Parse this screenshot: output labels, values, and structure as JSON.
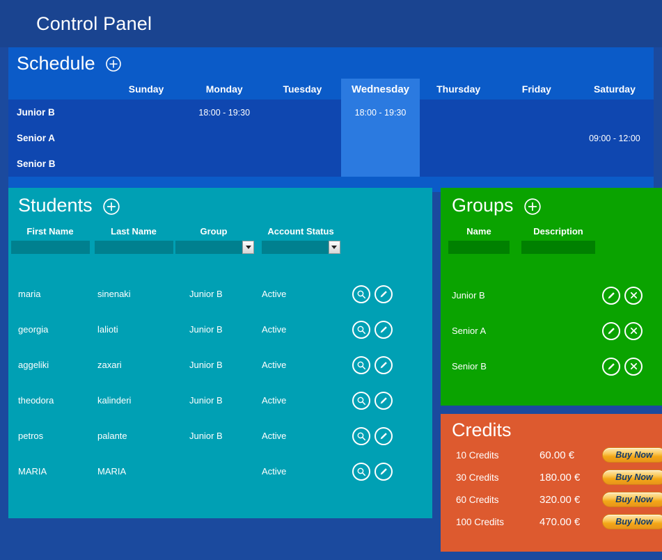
{
  "topbar": {
    "title": "Control Panel"
  },
  "schedule": {
    "title": "Schedule",
    "add_icon": "plus-circle-icon",
    "days": [
      "Sunday",
      "Monday",
      "Tuesday",
      "Wednesday",
      "Thursday",
      "Friday",
      "Saturday"
    ],
    "highlighted_day": "Wednesday",
    "rows": [
      {
        "group": "Junior B",
        "cells": [
          "",
          "18:00 - 19:30",
          "",
          "18:00 - 19:30",
          "",
          "",
          ""
        ]
      },
      {
        "group": "Senior A",
        "cells": [
          "",
          "",
          "",
          "",
          "",
          "",
          "09:00 - 12:00"
        ]
      },
      {
        "group": "Senior B",
        "cells": [
          "",
          "",
          "",
          "",
          "",
          "",
          ""
        ]
      }
    ]
  },
  "students": {
    "title": "Students",
    "add_icon": "plus-circle-icon",
    "columns": [
      "First Name",
      "Last Name",
      "Group",
      "Account Status"
    ],
    "filters": {
      "first_name": "",
      "last_name": "",
      "group": "",
      "account_status": ""
    },
    "rows": [
      {
        "first_name": "maria",
        "last_name": "sinenaki",
        "group": "Junior B",
        "status": "Active",
        "view_icon": "search-icon",
        "edit_icon": "pencil-icon"
      },
      {
        "first_name": "georgia",
        "last_name": "lalioti",
        "group": "Junior B",
        "status": "Active",
        "view_icon": "search-icon",
        "edit_icon": "pencil-icon"
      },
      {
        "first_name": "aggeliki",
        "last_name": "zaxari",
        "group": "Junior B",
        "status": "Active",
        "view_icon": "search-icon",
        "edit_icon": "pencil-icon"
      },
      {
        "first_name": "theodora",
        "last_name": "kalinderi",
        "group": "Junior B",
        "status": "Active",
        "view_icon": "search-icon",
        "edit_icon": "pencil-icon"
      },
      {
        "first_name": "petros",
        "last_name": "palante",
        "group": "Junior B",
        "status": "Active",
        "view_icon": "search-icon",
        "edit_icon": "pencil-icon"
      },
      {
        "first_name": "MARIA",
        "last_name": "MARIA",
        "group": "",
        "status": "Active",
        "view_icon": "search-icon",
        "edit_icon": "pencil-icon"
      }
    ]
  },
  "groups": {
    "title": "Groups",
    "add_icon": "plus-circle-icon",
    "columns": [
      "Name",
      "Description"
    ],
    "filters": {
      "name": "",
      "description": ""
    },
    "rows": [
      {
        "name": "Junior B",
        "description": "",
        "edit_icon": "pencil-icon",
        "delete_icon": "close-icon"
      },
      {
        "name": "Senior A",
        "description": "",
        "edit_icon": "pencil-icon",
        "delete_icon": "close-icon"
      },
      {
        "name": "Senior B",
        "description": "",
        "edit_icon": "pencil-icon",
        "delete_icon": "close-icon"
      }
    ]
  },
  "credits": {
    "title": "Credits",
    "rows": [
      {
        "quantity": "10 Credits",
        "price": "60.00 €",
        "buy_label": "Buy Now"
      },
      {
        "quantity": "30 Credits",
        "price": "180.00 €",
        "buy_label": "Buy Now"
      },
      {
        "quantity": "60 Credits",
        "price": "320.00 €",
        "buy_label": "Buy Now"
      },
      {
        "quantity": "100 Credits",
        "price": "470.00 €",
        "buy_label": "Buy Now"
      }
    ]
  },
  "colors": {
    "page_bg": "#1b4a9e",
    "topbar_bg": "#1a4490",
    "schedule_bg": "#0b5bc8",
    "schedule_body": "#0f47b0",
    "schedule_highlight": "#2b7ae0",
    "students_bg": "#00a0b4",
    "students_field": "#00808f",
    "groups_bg": "#0aa300",
    "groups_field": "#008000",
    "credits_bg": "#dd5a2f",
    "buy_button": "#f3a717"
  }
}
